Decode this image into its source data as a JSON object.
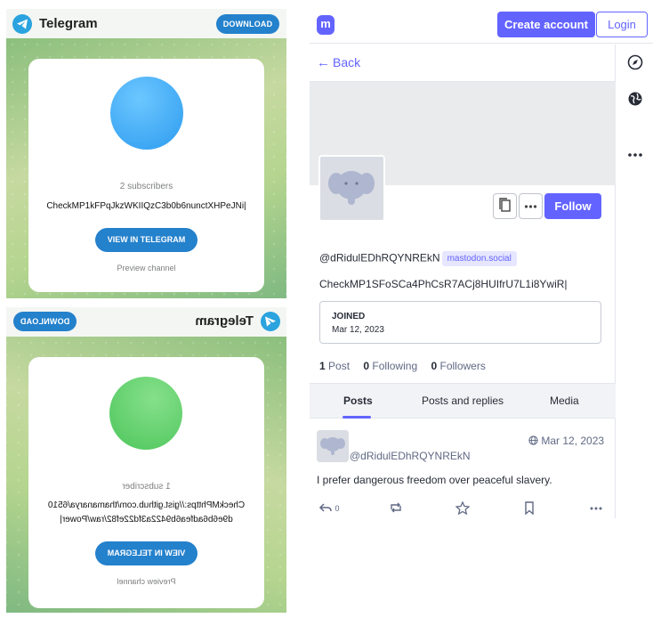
{
  "telegram_top": {
    "title": "Telegram",
    "download_label": "DOWNLOAD",
    "subscribers": "2 subscribers",
    "channel_name": "CheckMP1kFPqJkzWKIIQzC3b0b6nunctXHPeJNi|",
    "view_label": "VIEW IN TELEGRAM",
    "preview_label": "Preview channel",
    "avatar_color": "#3fa9f5"
  },
  "telegram_bottom": {
    "title": "Telegram",
    "download_label": "DOWNLOAD",
    "subscribers": "1 subscriber",
    "channel_name_line1": "CheckMPhttps://gist.github.com/thamanarya/6510",
    "channel_name_line2": "d9e6b6adfea6b9422a3fd22ef82/raw/Power|",
    "view_label": "VIEW IN TELEGRAM",
    "preview_label": "Preview channel",
    "avatar_color": "#5fd068",
    "mirrored": true
  },
  "mastodon": {
    "logo_icon": "mastodon-logo-icon",
    "create_account_label": "Create account",
    "login_label": "Login",
    "back_label": "Back",
    "follow_label": "Follow",
    "handle": "@dRidulEDhRQYNREkN",
    "server": "mastodon.social",
    "bio": "CheckMP1SFoSCa4PhCsR7ACj8HUIfrU7L1i8YwiR|",
    "joined_label": "JOINED",
    "joined_date": "Mar 12, 2023",
    "counts": [
      {
        "value": "1",
        "label": "Post"
      },
      {
        "value": "0",
        "label": "Following"
      },
      {
        "value": "0",
        "label": "Followers"
      }
    ],
    "tabs": [
      "Posts",
      "Posts and replies",
      "Media"
    ],
    "active_tab": "Posts",
    "post": {
      "handle": "@dRidulEDhRQYNREkN",
      "date": "Mar 12, 2023",
      "text": "I prefer dangerous freedom over peaceful slavery.",
      "reply_count": "0"
    },
    "accent_color": "#6364ff"
  }
}
